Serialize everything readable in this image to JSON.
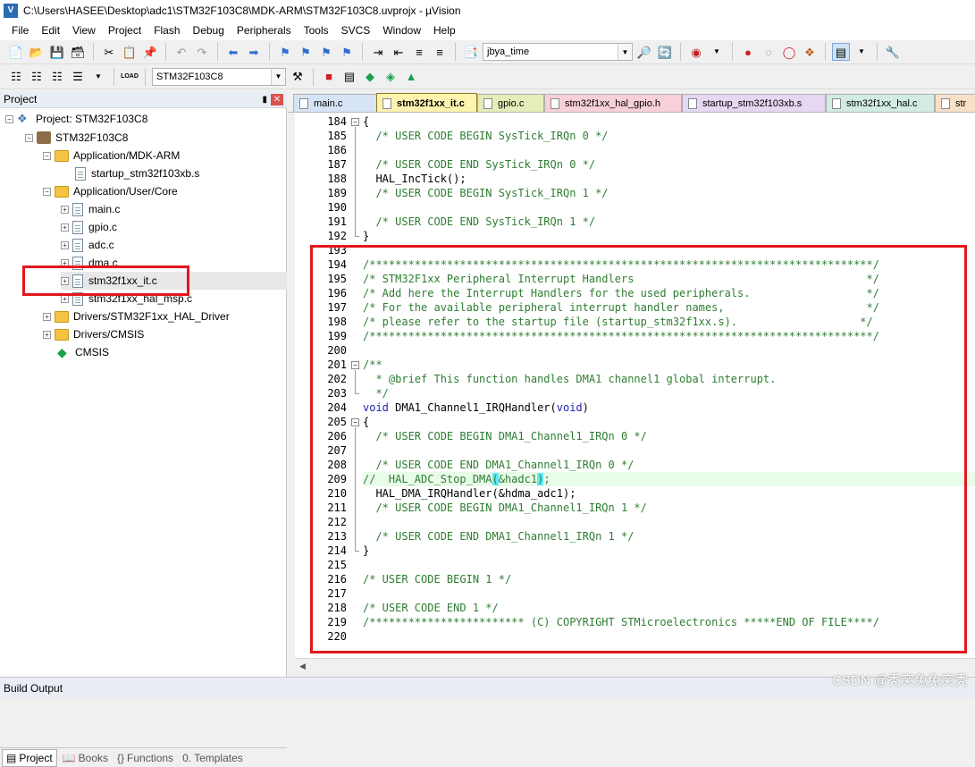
{
  "window": {
    "title": "C:\\Users\\HASEE\\Desktop\\adc1\\STM32F103C8\\MDK-ARM\\STM32F103C8.uvprojx - µVision",
    "app_icon_label": "V"
  },
  "menu": [
    "File",
    "Edit",
    "View",
    "Project",
    "Flash",
    "Debug",
    "Peripherals",
    "Tools",
    "SVCS",
    "Window",
    "Help"
  ],
  "toolbar": {
    "search_combo_value": "jbya_time",
    "target_combo_value": "STM32F103C8",
    "load_label": "LOAD"
  },
  "project_panel": {
    "header": "Project",
    "tree": {
      "root": "Project: STM32F103C8",
      "target": "STM32F103C8",
      "group_mdk": "Application/MDK-ARM",
      "startup": "startup_stm32f103xb.s",
      "group_core": "Application/User/Core",
      "files": [
        "main.c",
        "gpio.c",
        "adc.c",
        "dma.c",
        "stm32f1xx_it.c",
        "stm32f1xx_hal_msp.c"
      ],
      "group_hal": "Drivers/STM32F1xx_HAL_Driver",
      "group_cmsis": "Drivers/CMSIS",
      "cmsis": "CMSIS"
    },
    "bottom_tabs": [
      "Project",
      "Books",
      "Functions",
      "Templates"
    ]
  },
  "editor_tabs": [
    {
      "label": "main.c",
      "color": "#d6e4f5",
      "active": false
    },
    {
      "label": "stm32f1xx_it.c",
      "color": "#fff3b0",
      "active": true
    },
    {
      "label": "gpio.c",
      "color": "#e4eeb8",
      "active": false
    },
    {
      "label": "stm32f1xx_hal_gpio.h",
      "color": "#f8d0d8",
      "active": false
    },
    {
      "label": "startup_stm32f103xb.s",
      "color": "#e6d7f2",
      "active": false
    },
    {
      "label": "stm32f1xx_hal.c",
      "color": "#d2ece4",
      "active": false
    },
    {
      "label": "str",
      "color": "#f8e0c8",
      "active": false
    }
  ],
  "code_lines": [
    {
      "n": "184",
      "text": "{",
      "cls": "c-plain"
    },
    {
      "n": "185",
      "text": "  /* USER CODE BEGIN SysTick_IRQn 0 */",
      "cls": "c-comment"
    },
    {
      "n": "186",
      "text": "",
      "cls": "c-plain"
    },
    {
      "n": "187",
      "text": "  /* USER CODE END SysTick_IRQn 0 */",
      "cls": "c-comment"
    },
    {
      "n": "188",
      "text": "  HAL_IncTick();",
      "cls": "c-plain"
    },
    {
      "n": "189",
      "text": "  /* USER CODE BEGIN SysTick_IRQn 1 */",
      "cls": "c-comment"
    },
    {
      "n": "190",
      "text": "",
      "cls": "c-plain"
    },
    {
      "n": "191",
      "text": "  /* USER CODE END SysTick_IRQn 1 */",
      "cls": "c-comment"
    },
    {
      "n": "192",
      "text": "}",
      "cls": "c-plain"
    },
    {
      "n": "193",
      "text": "",
      "cls": "c-plain"
    },
    {
      "n": "194",
      "text": "/******************************************************************************/",
      "cls": "c-comment"
    },
    {
      "n": "195",
      "text": "/* STM32F1xx Peripheral Interrupt Handlers                                    */",
      "cls": "c-comment"
    },
    {
      "n": "196",
      "text": "/* Add here the Interrupt Handlers for the used peripherals.                  */",
      "cls": "c-comment"
    },
    {
      "n": "197",
      "text": "/* For the available peripheral interrupt handler names,                      */",
      "cls": "c-comment"
    },
    {
      "n": "198",
      "text": "/* please refer to the startup file (startup_stm32f1xx.s).                   */",
      "cls": "c-comment"
    },
    {
      "n": "199",
      "text": "/******************************************************************************/",
      "cls": "c-comment"
    },
    {
      "n": "200",
      "text": "",
      "cls": "c-plain"
    },
    {
      "n": "201",
      "text": "/**",
      "cls": "c-comment"
    },
    {
      "n": "202",
      "text": "  * @brief This function handles DMA1 channel1 global interrupt.",
      "cls": "c-comment"
    },
    {
      "n": "203",
      "text": "  */",
      "cls": "c-comment"
    },
    {
      "n": "204",
      "text": "void DMA1_Channel1_IRQHandler(void)",
      "cls": "c-plain"
    },
    {
      "n": "205",
      "text": "{",
      "cls": "c-plain"
    },
    {
      "n": "206",
      "text": "  /* USER CODE BEGIN DMA1_Channel1_IRQn 0 */",
      "cls": "c-comment"
    },
    {
      "n": "207",
      "text": "",
      "cls": "c-plain"
    },
    {
      "n": "208",
      "text": "  /* USER CODE END DMA1_Channel1_IRQn 0 */",
      "cls": "c-comment"
    },
    {
      "n": "209",
      "text": "//  HAL_ADC_Stop_DMA(&hadc1);",
      "cls": "c-comment"
    },
    {
      "n": "210",
      "text": "  HAL_DMA_IRQHandler(&hdma_adc1);",
      "cls": "c-plain"
    },
    {
      "n": "211",
      "text": "  /* USER CODE BEGIN DMA1_Channel1_IRQn 1 */",
      "cls": "c-comment"
    },
    {
      "n": "212",
      "text": "",
      "cls": "c-plain"
    },
    {
      "n": "213",
      "text": "  /* USER CODE END DMA1_Channel1_IRQn 1 */",
      "cls": "c-comment"
    },
    {
      "n": "214",
      "text": "}",
      "cls": "c-plain"
    },
    {
      "n": "215",
      "text": "",
      "cls": "c-plain"
    },
    {
      "n": "216",
      "text": "/* USER CODE BEGIN 1 */",
      "cls": "c-comment"
    },
    {
      "n": "217",
      "text": "",
      "cls": "c-plain"
    },
    {
      "n": "218",
      "text": "/* USER CODE END 1 */",
      "cls": "c-comment"
    },
    {
      "n": "219",
      "text": "/************************ (C) COPYRIGHT STMicroelectronics *****END OF FILE****/",
      "cls": "c-comment"
    },
    {
      "n": "220",
      "text": "",
      "cls": "c-plain"
    }
  ],
  "status": {
    "build_output": "Build Output",
    "watermark": "CSDN @秃突兔兔突秃"
  },
  "colors": {
    "annotation_red": "#e3161c",
    "comment_green": "#2e7d32",
    "keyword_blue": "#1f1fb0",
    "bracket_highlight": "#60e8ff"
  }
}
